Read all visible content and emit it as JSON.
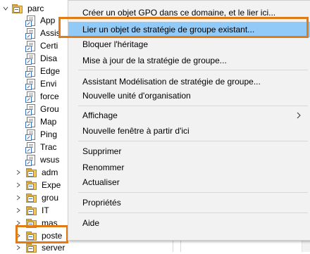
{
  "tree": {
    "root": "parc",
    "gpos": [
      "App",
      "Assis",
      "Certi",
      "Disa",
      "Edge",
      "Envi",
      "force",
      "Grou",
      "Map",
      "Ping",
      "Trac",
      "wsus"
    ],
    "ous": [
      "adm",
      "Expe",
      "grou",
      "IT",
      "mas",
      "poste",
      "server"
    ]
  },
  "menu": {
    "items": [
      "Créer un objet GPO dans ce domaine, et le lier ici...",
      "Lier un objet de stratégie de groupe existant...",
      "Bloquer l'héritage",
      "Mise à jour de la stratégie de groupe...",
      "Assistant Modélisation de stratégie de groupe...",
      "Nouvelle unité d'organisation",
      "Affichage",
      "Nouvelle fenêtre à partir d'ici",
      "Supprimer",
      "Renommer",
      "Actualiser",
      "Propriétés",
      "Aide"
    ]
  },
  "colors": {
    "highlight": "#91c9f7",
    "outline": "#e07b16"
  }
}
